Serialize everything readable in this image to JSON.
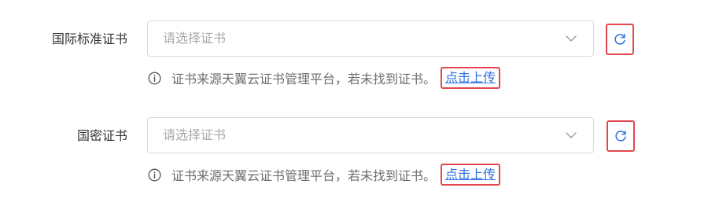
{
  "fields": [
    {
      "label": "国际标准证书",
      "placeholder": "请选择证书",
      "hint": "证书来源天翼云证书管理平台，若未找到证书。",
      "upload_link": "点击上传"
    },
    {
      "label": "国密证书",
      "placeholder": "请选择证书",
      "hint": "证书来源天翼云证书管理平台，若未找到证书。",
      "upload_link": "点击上传"
    }
  ],
  "icons": {
    "chevron": "chevron-down-icon",
    "refresh": "refresh-icon",
    "info": "info-circle-icon"
  },
  "colors": {
    "link": "#2f6fe0",
    "highlight_border": "#e2474f",
    "placeholder": "#a8a8a8",
    "input_border": "#d9d9d9"
  }
}
